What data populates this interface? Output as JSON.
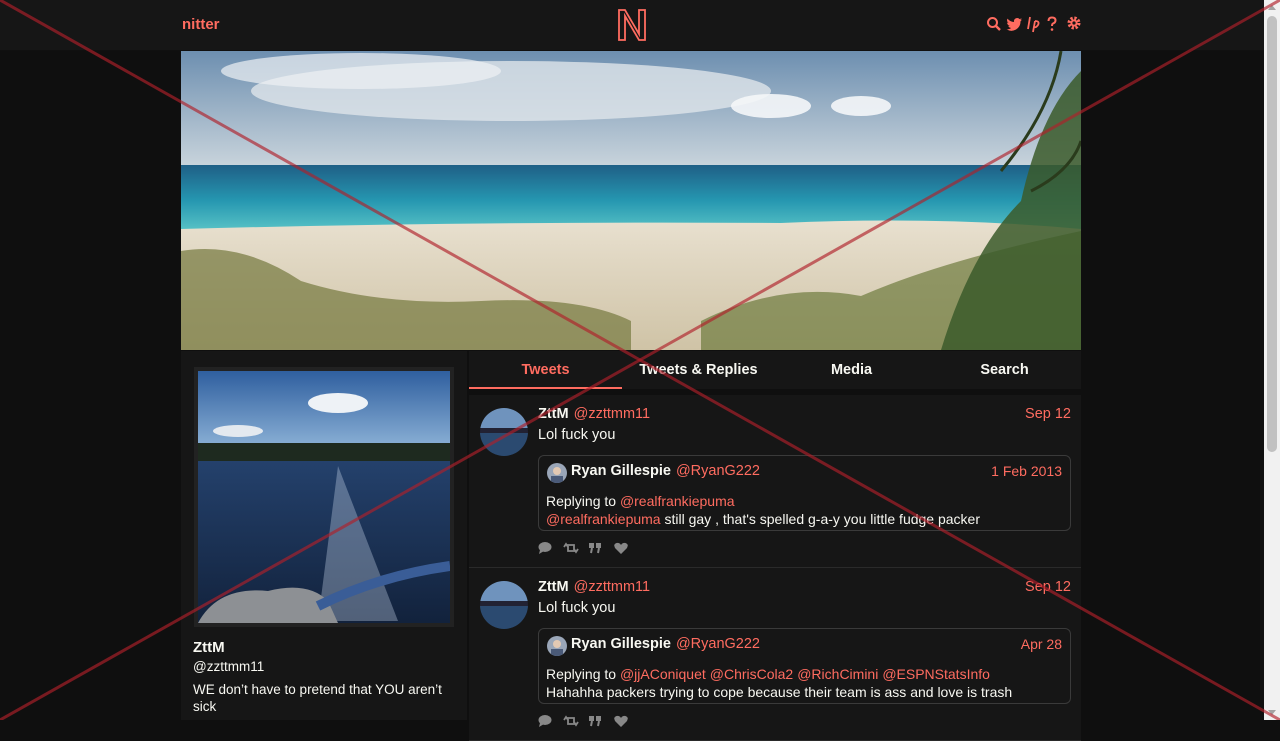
{
  "brand": "nitter",
  "nav_icons": [
    "search-icon",
    "twitter-bird-icon",
    "lp-icon",
    "help-icon",
    "settings-gear-icon"
  ],
  "colors": {
    "accent": "#ff6c60",
    "background": "#0f0f0f",
    "panel": "#161616",
    "overlay_cross": "#b0202a"
  },
  "profile": {
    "name": "ZttM",
    "handle": "@zzttmm11",
    "bio": "WE don’t have to pretend that YOU aren’t sick"
  },
  "tabs": [
    {
      "label": "Tweets",
      "active": true
    },
    {
      "label": "Tweets & Replies",
      "active": false
    },
    {
      "label": "Media",
      "active": false
    },
    {
      "label": "Search",
      "active": false
    }
  ],
  "tweets": [
    {
      "name": "ZttM",
      "handle": "@zzttmm11",
      "date": "Sep 12",
      "text": "Lol fuck you",
      "quote": {
        "name": "Ryan Gillespie",
        "handle": "@RyanG222",
        "date": "1 Feb 2013",
        "replying_to_label": "Replying to",
        "replying_to": [
          "@realfrankiepuma"
        ],
        "mention": "@realfrankiepuma",
        "text": "still gay , that's spelled g-a-y you little fudge packer"
      },
      "stats_icons": [
        "comment-icon",
        "retweet-icon",
        "quote-icon",
        "heart-icon"
      ]
    },
    {
      "name": "ZttM",
      "handle": "@zzttmm11",
      "date": "Sep 12",
      "text": "Lol fuck you",
      "quote": {
        "name": "Ryan Gillespie",
        "handle": "@RyanG222",
        "date": "Apr 28",
        "replying_to_label": "Replying to",
        "replying_to": [
          "@jjAConiquet",
          "@ChrisCola2",
          "@RichCimini",
          "@ESPNStatsInfo"
        ],
        "text": "Hahahha packers trying to cope because their team is ass and love is trash"
      },
      "stats_icons": [
        "comment-icon",
        "retweet-icon",
        "quote-icon",
        "heart-icon"
      ]
    }
  ]
}
